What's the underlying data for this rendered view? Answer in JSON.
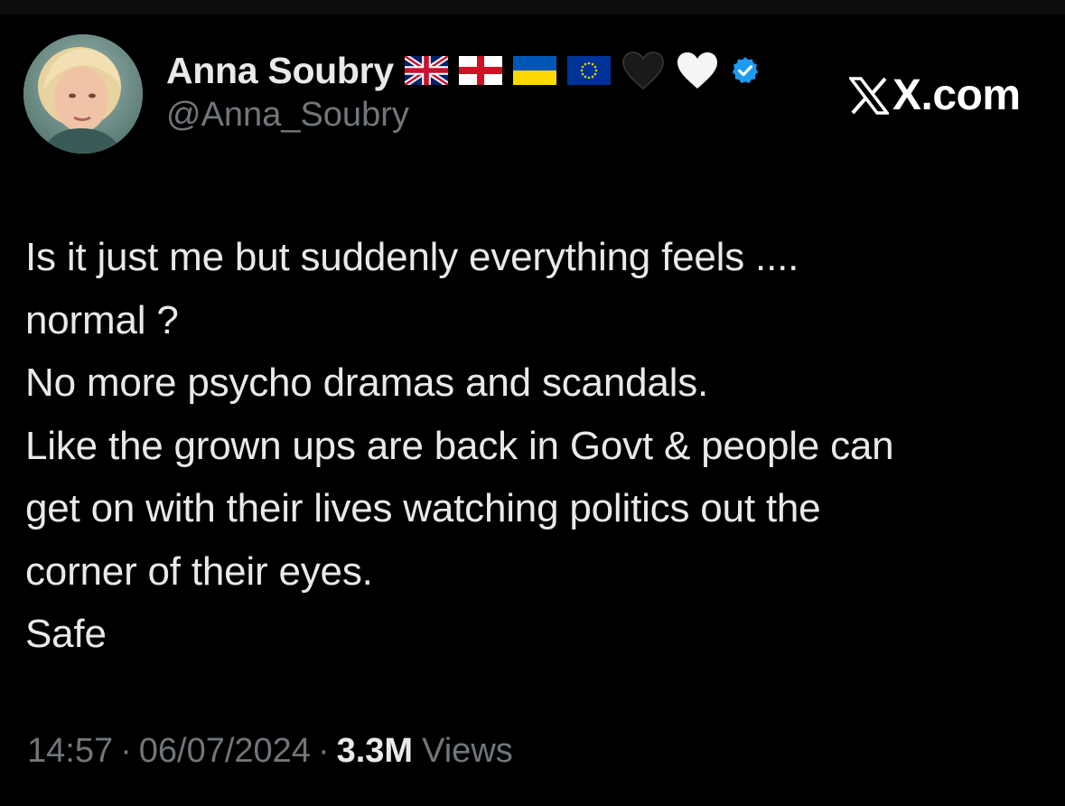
{
  "post": {
    "author": {
      "display_name": "Anna Soubry",
      "handle": "@Anna_Soubry",
      "avatar_icon": "profile-photo-avatar",
      "verified_badge_color": "#1d9bf0",
      "emoji_icons": [
        "uk-flag-icon",
        "england-flag-icon",
        "ukraine-flag-icon",
        "eu-flag-icon",
        "black-heart-icon",
        "white-heart-icon"
      ]
    },
    "brand": {
      "text": "X.com"
    },
    "body_lines": [
      "Is it just me but suddenly everything feels  ....",
      "normal ?",
      "No more psycho dramas and scandals.",
      "Like the grown ups are back in Govt & people can",
      "get on with their lives watching politics out the",
      "corner of their eyes.",
      "Safe"
    ],
    "meta": {
      "time": "14:57",
      "separator": "·",
      "date": "06/07/2024",
      "views_count": "3.3M",
      "views_label": "Views"
    }
  },
  "colors": {
    "background": "#000000",
    "primary_text": "#e7e9ea",
    "secondary_text": "#71767b",
    "accent": "#1d9bf0"
  }
}
